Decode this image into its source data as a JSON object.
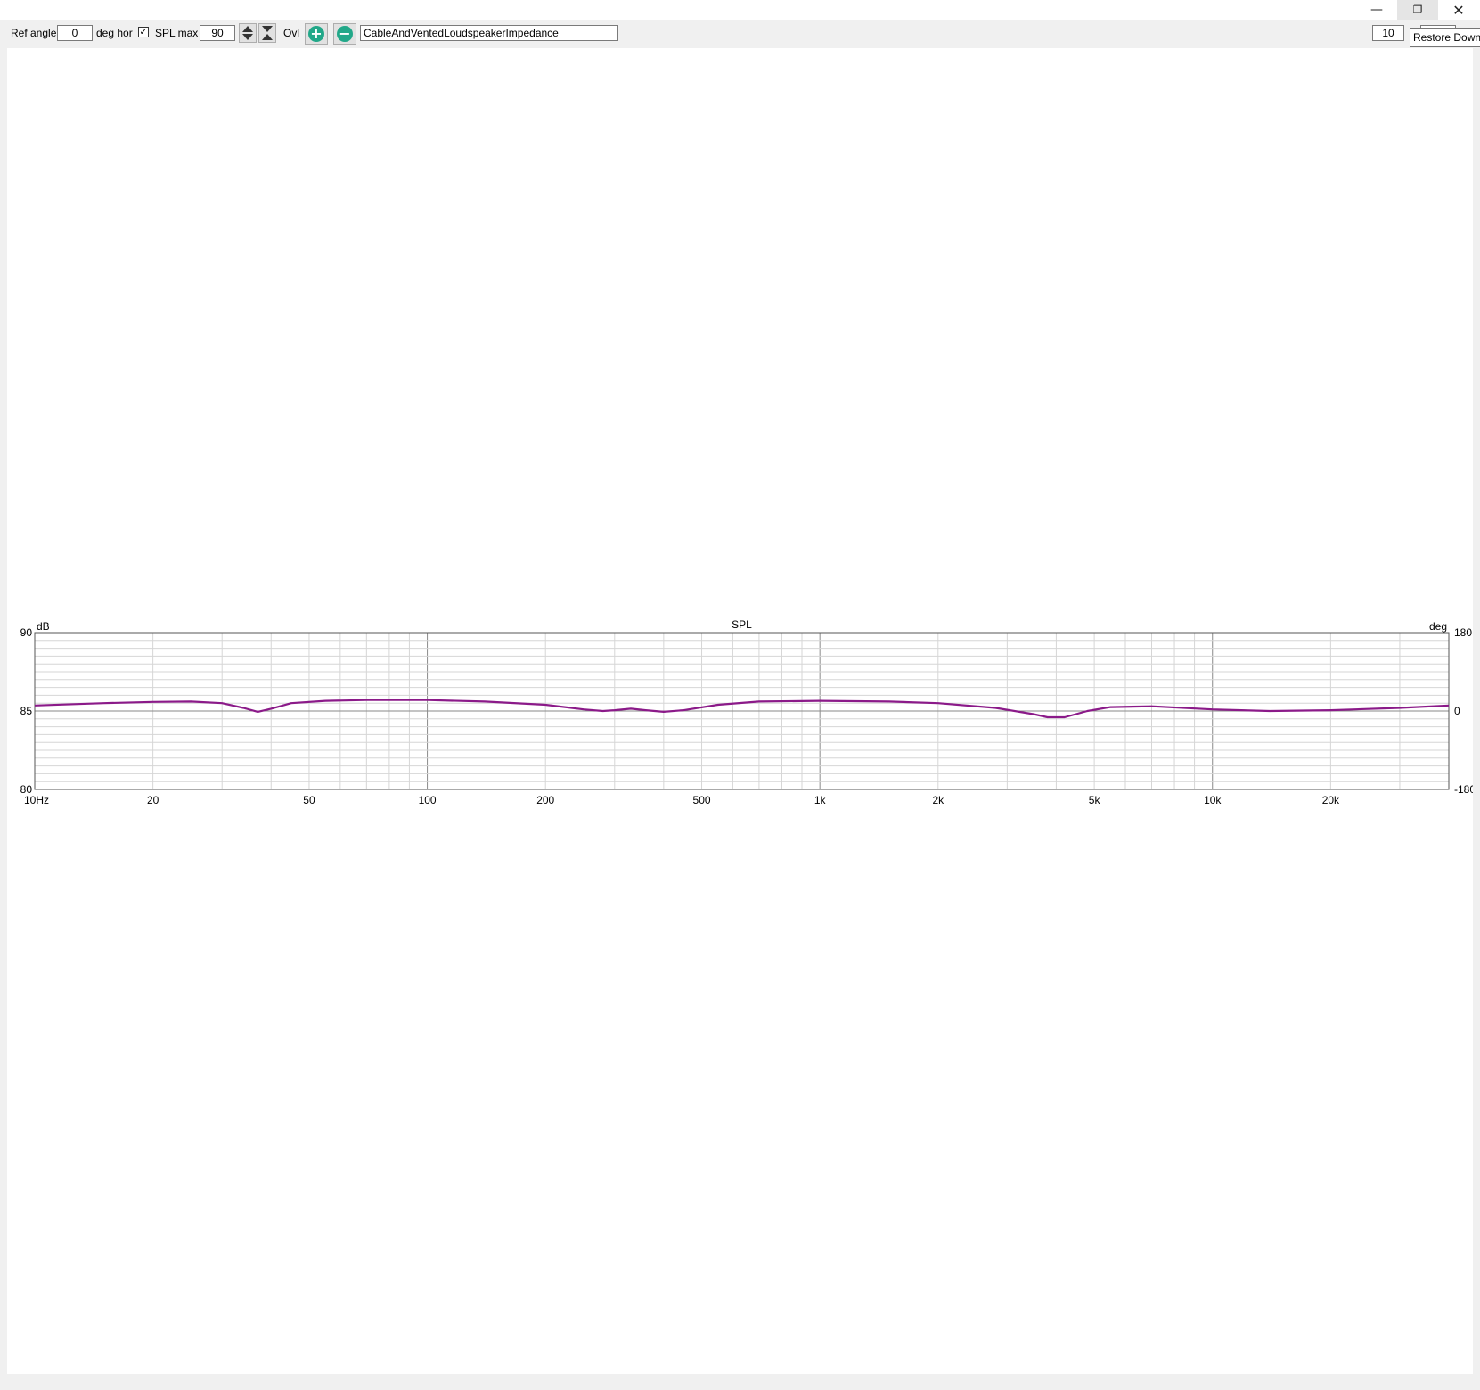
{
  "window": {
    "minimize_icon": "minimize-icon",
    "restore_icon": "restore-icon",
    "close_icon": "close-icon",
    "tooltip": "Restore Down"
  },
  "toolbar": {
    "ref_angle_label": "Ref angle",
    "ref_angle_value": "0",
    "deg_hor_label": "deg hor",
    "spl_max_checked": true,
    "spl_max_label": "SPL max",
    "spl_max_value": "90",
    "ovl_label": "Ovl",
    "add_icon": "plus-icon",
    "remove_icon": "minus-icon",
    "overlay_name": "CableAndVentedLoudspeakerImpedance",
    "right_value": "10"
  },
  "chart_data": {
    "type": "line",
    "title": "SPL",
    "ylabel_left": "dB",
    "ylabel_right": "deg",
    "x_scale": "log",
    "xlim": [
      10,
      40000
    ],
    "ylim": [
      80,
      90
    ],
    "y2lim": [
      -180,
      180
    ],
    "grid": true,
    "x_tick_labels": [
      {
        "value": 10,
        "label": "10Hz"
      },
      {
        "value": 20,
        "label": "20"
      },
      {
        "value": 50,
        "label": "50"
      },
      {
        "value": 100,
        "label": "100"
      },
      {
        "value": 200,
        "label": "200"
      },
      {
        "value": 500,
        "label": "500"
      },
      {
        "value": 1000,
        "label": "1k"
      },
      {
        "value": 2000,
        "label": "2k"
      },
      {
        "value": 5000,
        "label": "5k"
      },
      {
        "value": 10000,
        "label": "10k"
      },
      {
        "value": 20000,
        "label": "20k"
      }
    ],
    "y_tick_labels": [
      {
        "value": 90,
        "label": "90"
      },
      {
        "value": 85,
        "label": "85"
      },
      {
        "value": 80,
        "label": "80"
      }
    ],
    "y2_tick_labels": [
      {
        "value": 180,
        "label": "180"
      },
      {
        "value": 0,
        "label": "0"
      },
      {
        "value": -180,
        "label": "-180"
      }
    ],
    "series": [
      {
        "color": "#8b1a89",
        "points": [
          [
            10,
            85.35
          ],
          [
            15,
            85.5
          ],
          [
            20,
            85.58
          ],
          [
            25,
            85.6
          ],
          [
            30,
            85.5
          ],
          [
            34,
            85.2
          ],
          [
            37,
            84.95
          ],
          [
            40,
            85.15
          ],
          [
            45,
            85.5
          ],
          [
            55,
            85.65
          ],
          [
            70,
            85.7
          ],
          [
            100,
            85.7
          ],
          [
            140,
            85.6
          ],
          [
            200,
            85.4
          ],
          [
            250,
            85.1
          ],
          [
            280,
            85.0
          ],
          [
            300,
            85.05
          ],
          [
            330,
            85.15
          ],
          [
            360,
            85.05
          ],
          [
            400,
            84.95
          ],
          [
            450,
            85.05
          ],
          [
            550,
            85.4
          ],
          [
            700,
            85.6
          ],
          [
            1000,
            85.65
          ],
          [
            1500,
            85.6
          ],
          [
            2000,
            85.5
          ],
          [
            2800,
            85.2
          ],
          [
            3500,
            84.8
          ],
          [
            3800,
            84.6
          ],
          [
            4200,
            84.6
          ],
          [
            4800,
            85.0
          ],
          [
            5500,
            85.25
          ],
          [
            7000,
            85.3
          ],
          [
            10000,
            85.1
          ],
          [
            14000,
            85.0
          ],
          [
            20000,
            85.05
          ],
          [
            30000,
            85.2
          ],
          [
            40000,
            85.35
          ]
        ]
      }
    ]
  }
}
